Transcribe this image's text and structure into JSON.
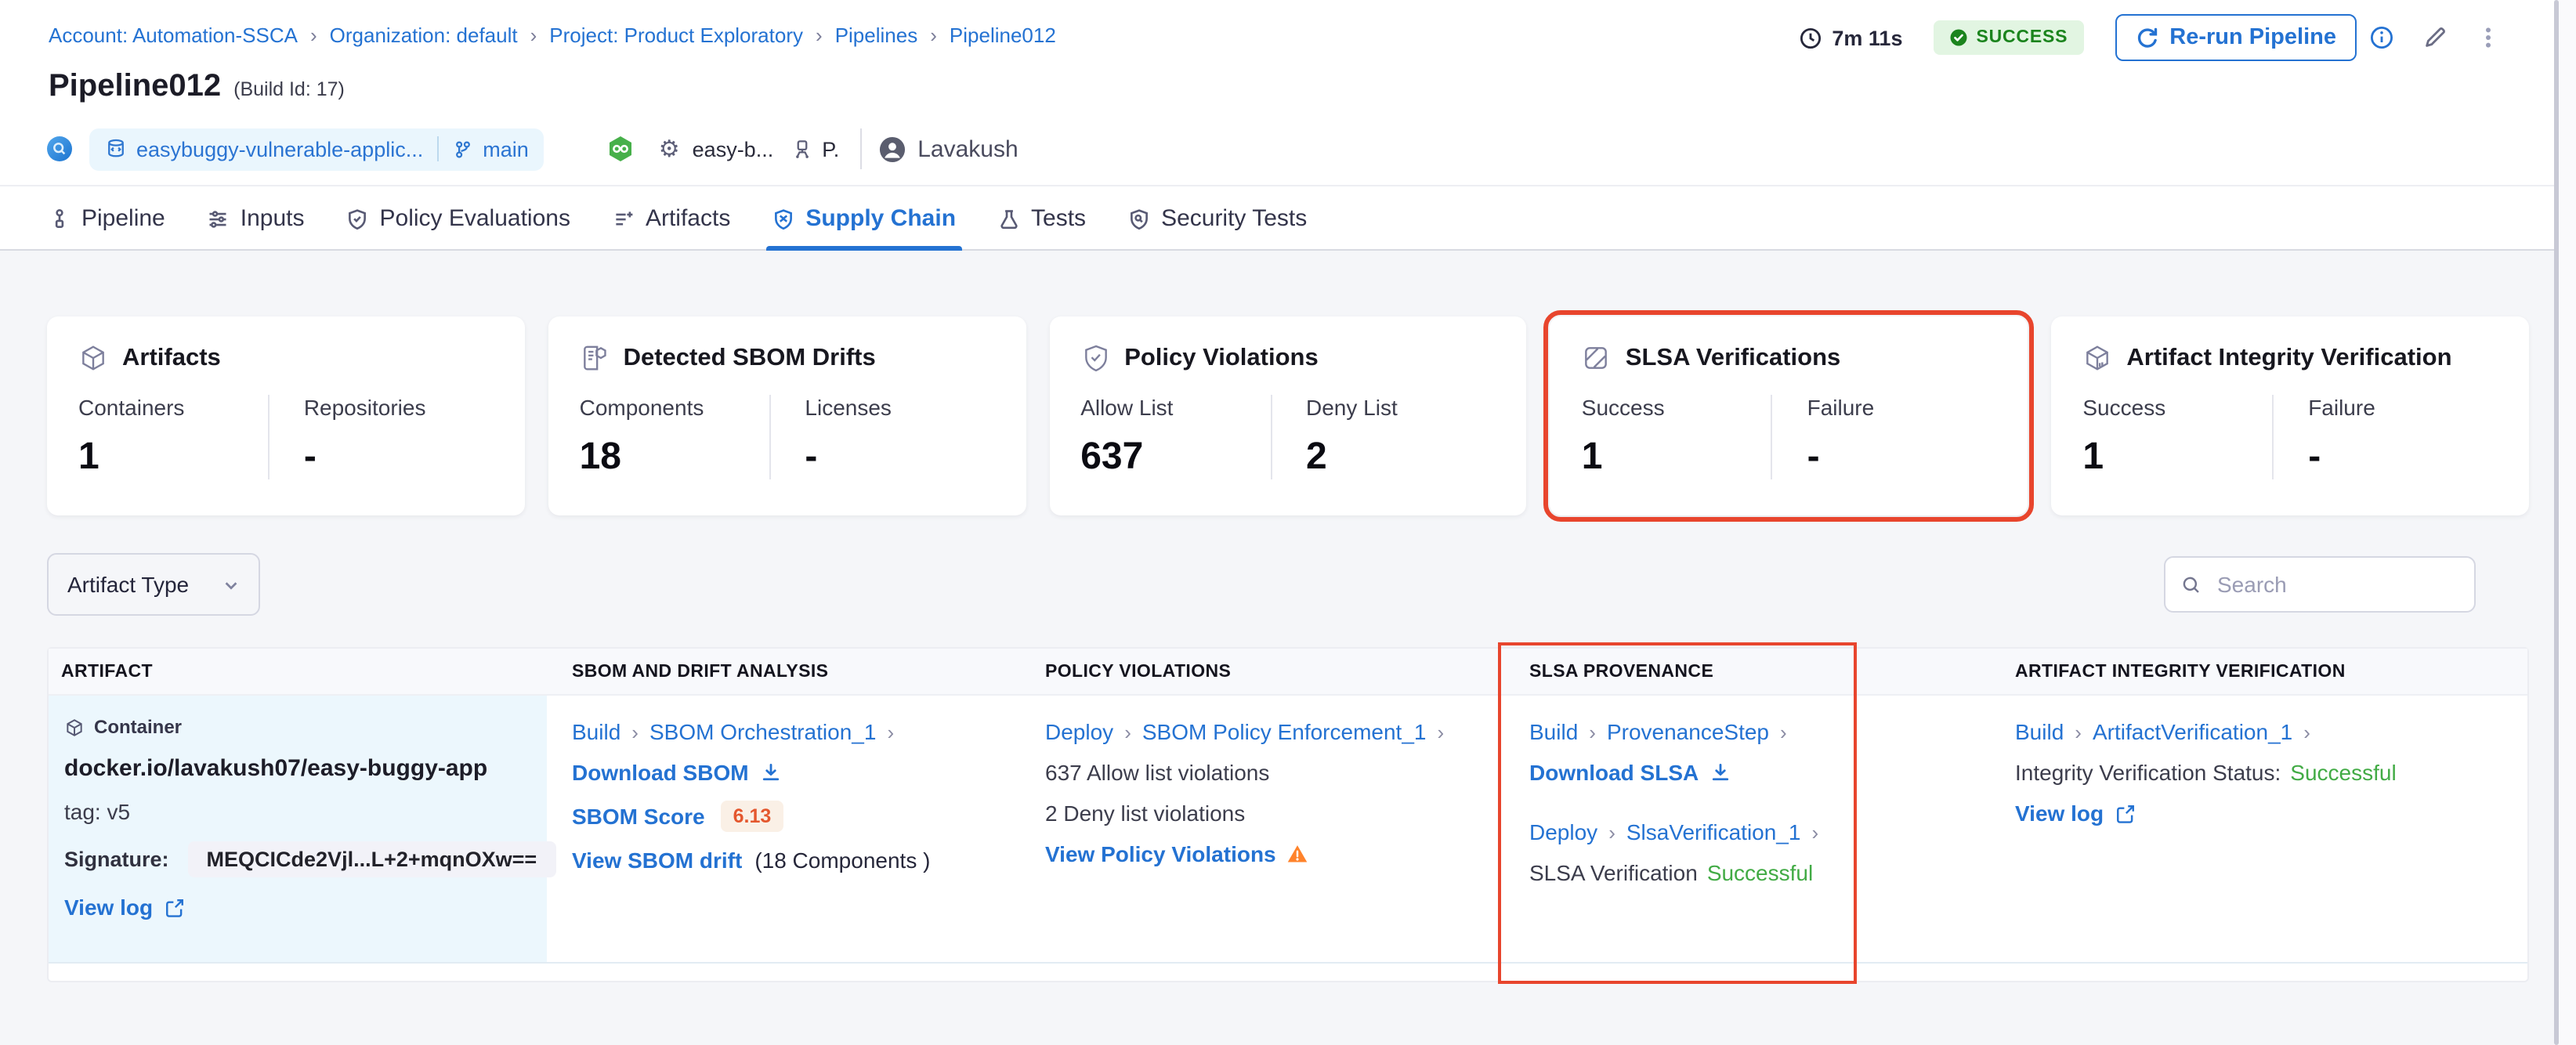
{
  "ui": {
    "chevron": "›"
  },
  "colors": {
    "accent_blue": "#2472d2",
    "success_badge_green": "#1b841d",
    "status_green": "#42ab45",
    "annotation_red": "#e8452d",
    "warning_orange": "#ff832b",
    "score_orange": "#e4572e"
  },
  "breadcrumb": [
    "Account: Automation-SSCA",
    "Organization: default",
    "Project: Product Exploratory",
    "Pipelines",
    "Pipeline012"
  ],
  "topbar": {
    "duration": "7m 11s",
    "status": "SUCCESS",
    "rerun_label": "Re-run Pipeline"
  },
  "header": {
    "title": "Pipeline012",
    "build_id": "(Build Id: 17)",
    "repo": "easybuggy-vulnerable-applic...",
    "branch": "main",
    "service": "easy-b...",
    "environment": "P.",
    "user": "Lavakush"
  },
  "tabs": [
    {
      "label": "Pipeline",
      "active": false
    },
    {
      "label": "Inputs",
      "active": false
    },
    {
      "label": "Policy Evaluations",
      "active": false
    },
    {
      "label": "Artifacts",
      "active": false
    },
    {
      "label": "Supply Chain",
      "active": true
    },
    {
      "label": "Tests",
      "active": false
    },
    {
      "label": "Security Tests",
      "active": false
    }
  ],
  "cards": [
    {
      "title": "Artifacts",
      "metrics": [
        {
          "label": "Containers",
          "value": "1"
        },
        {
          "label": "Repositories",
          "value": "-"
        }
      ]
    },
    {
      "title": "Detected SBOM Drifts",
      "metrics": [
        {
          "label": "Components",
          "value": "18"
        },
        {
          "label": "Licenses",
          "value": "-"
        }
      ]
    },
    {
      "title": "Policy Violations",
      "metrics": [
        {
          "label": "Allow List",
          "value": "637"
        },
        {
          "label": "Deny List",
          "value": "2"
        }
      ]
    },
    {
      "title": "SLSA Verifications",
      "highlighted": true,
      "metrics": [
        {
          "label": "Success",
          "value": "1"
        },
        {
          "label": "Failure",
          "value": "-"
        }
      ]
    },
    {
      "title": "Artifact Integrity Verification",
      "metrics": [
        {
          "label": "Success",
          "value": "1"
        },
        {
          "label": "Failure",
          "value": "-"
        }
      ]
    }
  ],
  "filters": {
    "artifact_type_label": "Artifact Type",
    "search_placeholder": "Search"
  },
  "table": {
    "columns": [
      "ARTIFACT",
      "SBOM AND DRIFT ANALYSIS",
      "POLICY VIOLATIONS",
      "SLSA PROVENANCE",
      "ARTIFACT INTEGRITY VERIFICATION"
    ],
    "row": {
      "artifact": {
        "type_badge": "Container",
        "name": "docker.io/lavakush07/easy-buggy-app",
        "tag": "tag: v5",
        "signature_label": "Signature:",
        "signature_value": "MEQCICde2Vjl...L+2+mqnOXw==",
        "view_log_label": "View log"
      },
      "sbom": {
        "stage": "Build",
        "step": "SBOM Orchestration_1",
        "download_label": "Download SBOM",
        "score_label": "SBOM Score",
        "score_value": "6.13",
        "drift_label": "View SBOM drift",
        "drift_count": "(18 Components )"
      },
      "policy": {
        "stage": "Deploy",
        "step": "SBOM Policy Enforcement_1",
        "allow_text": "637 Allow list violations",
        "deny_text": "2 Deny list violations",
        "view_label": "View Policy Violations"
      },
      "slsa": {
        "stage1": "Build",
        "step1": "ProvenanceStep",
        "download_label": "Download SLSA",
        "stage2": "Deploy",
        "step2": "SlsaVerification_1",
        "status_prefix": "SLSA Verification",
        "status_value": "Successful"
      },
      "integrity": {
        "stage": "Build",
        "step": "ArtifactVerification_1",
        "status_prefix": "Integrity Verification Status:",
        "status_value": "Successful",
        "view_log_label": "View log"
      }
    }
  }
}
